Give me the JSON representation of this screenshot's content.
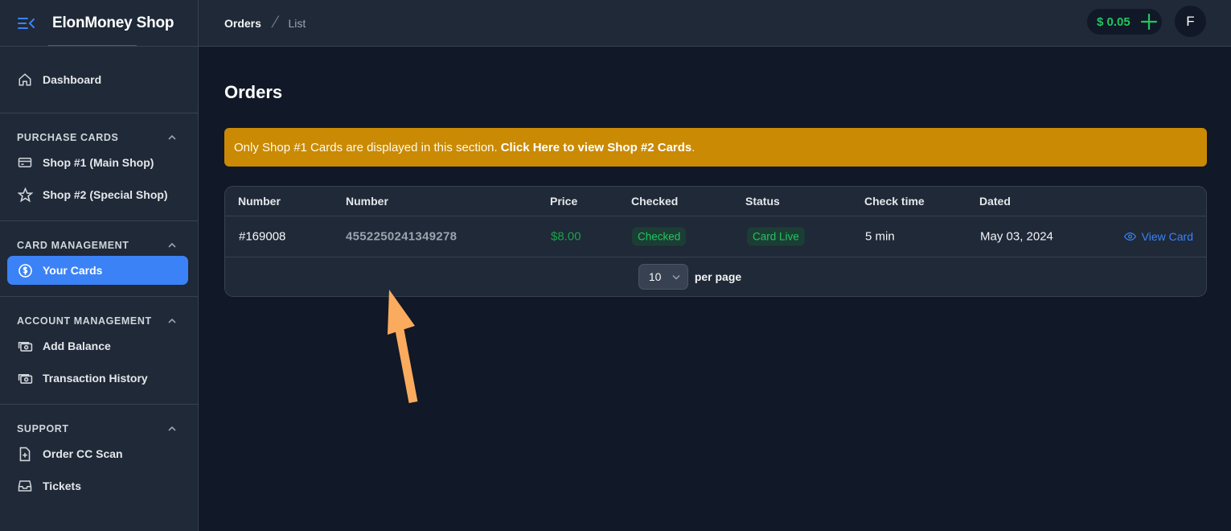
{
  "app": {
    "title": "ElonMoney Shop"
  },
  "sidebar": {
    "dashboard": {
      "label": "Dashboard",
      "icon": "home-icon"
    },
    "groups": [
      {
        "title": "PURCHASE CARDS",
        "items": [
          {
            "label": "Shop #1 (Main Shop)",
            "icon": "credit-card-icon"
          },
          {
            "label": "Shop #2 (Special Shop)",
            "icon": "star-icon"
          }
        ]
      },
      {
        "title": "CARD MANAGEMENT",
        "items": [
          {
            "label": "Your Cards",
            "icon": "dollar-circle-icon",
            "active": true
          }
        ]
      },
      {
        "title": "ACCOUNT MANAGEMENT",
        "items": [
          {
            "label": "Add Balance",
            "icon": "cash-icon"
          },
          {
            "label": "Transaction History",
            "icon": "cash-icon"
          }
        ]
      },
      {
        "title": "SUPPORT",
        "items": [
          {
            "label": "Order CC Scan",
            "icon": "document-plus-icon"
          },
          {
            "label": "Tickets",
            "icon": "inbox-icon"
          }
        ]
      }
    ]
  },
  "header": {
    "breadcrumb": [
      "Orders",
      "List"
    ],
    "balance": "$ 0.05",
    "avatar_initial": "F"
  },
  "main": {
    "title": "Orders",
    "notice": {
      "text": "Only Shop #1 Cards are displayed in this section.",
      "link": "Click Here to view Shop #2 Cards",
      "suffix": "."
    },
    "table": {
      "columns": [
        "Number",
        "Number",
        "Price",
        "Checked",
        "Status",
        "Check time",
        "Dated"
      ],
      "rows": [
        {
          "order": "#169008",
          "card_number": "4552250241349278",
          "price": "$8.00",
          "checked": "Checked",
          "status": "Card Live",
          "check_time": "5 min",
          "dated": "May 03, 2024",
          "action": "View Card"
        }
      ]
    },
    "pagination": {
      "per_page_value": "10",
      "per_page_label": "per page"
    }
  },
  "colors": {
    "accent": "#3b82f6",
    "notice_bg": "#ca8a04",
    "success": "#22c55e",
    "annotation_arrow": "#fbab5e"
  }
}
